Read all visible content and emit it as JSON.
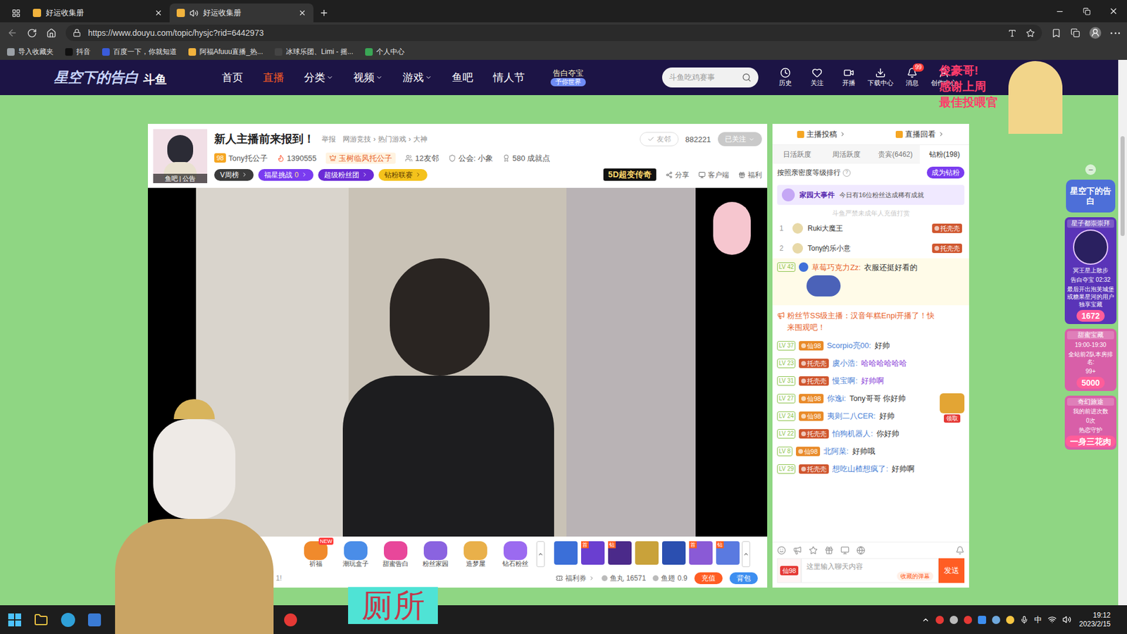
{
  "browser": {
    "tabs": [
      {
        "label": "好运收集册",
        "selected": false,
        "audio": false
      },
      {
        "label": "好运收集册",
        "selected": true,
        "audio": true
      }
    ],
    "url": "https://www.douyu.com/topic/hysjc?rid=6442973",
    "bookmarks": [
      "导入收藏夹",
      "抖音",
      "百度一下，你就知道",
      "阿福Afuuu直播_热...",
      "冰球乐团、Limi - 摇...",
      "个人中心"
    ]
  },
  "site": {
    "logo_title": "星空下的告白",
    "logo_brand": "斗鱼",
    "nav": [
      {
        "label": "首页",
        "selected": false,
        "dropdown": false
      },
      {
        "label": "直播",
        "selected": true,
        "dropdown": false
      },
      {
        "label": "分类",
        "selected": false,
        "dropdown": true
      },
      {
        "label": "视频",
        "selected": false,
        "dropdown": true
      },
      {
        "label": "游戏",
        "selected": false,
        "dropdown": true
      },
      {
        "label": "鱼吧",
        "selected": false,
        "dropdown": false
      },
      {
        "label": "情人节",
        "selected": false,
        "dropdown": false
      }
    ],
    "promo": {
      "title": "告白夺宝",
      "sub": "予你世界"
    },
    "search_placeholder": "斗鱼吃鸡赛事",
    "actions": [
      {
        "label": "历史",
        "badge": ""
      },
      {
        "label": "关注",
        "badge": ""
      },
      {
        "label": "开播",
        "badge": ""
      },
      {
        "label": "下载中心",
        "badge": ""
      },
      {
        "label": "消息",
        "badge": "99"
      },
      {
        "label": "创作中心",
        "badge": ""
      }
    ],
    "banner": [
      "俊豪哥!",
      "感谢上周",
      "最佳投喂官"
    ]
  },
  "room": {
    "avatar_label": "鱼吧 | 公告",
    "title": "新人主播前来报到！",
    "report": "举报",
    "category": [
      "网游竞技",
      "热门游戏",
      "大神"
    ],
    "category_sep": "›",
    "level": "98",
    "anchor": "Tony托公子",
    "heat": "1390555",
    "honor": "玉树临风托公子",
    "stats": [
      "12友邻",
      "公会: 小象",
      "580 成就点"
    ],
    "friend": "友邻",
    "followers": "882221",
    "follow": "已关注",
    "pills": [
      {
        "label": "V周榜",
        "count": "",
        "color": "#3b3b3b"
      },
      {
        "label": "福星挑战",
        "count": "0",
        "color": "#7a3cf0"
      },
      {
        "label": "超级粉丝团",
        "count": "",
        "color": "#6b2bd6"
      },
      {
        "label": "钻粉联赛",
        "count": "",
        "color": "#f4c21c"
      }
    ],
    "ad": "5D超变传奇",
    "links": [
      "分享",
      "客户端",
      "福利"
    ],
    "gifts": [
      {
        "label": "祈福",
        "badge": "NEW",
        "color": "#f08a2c"
      },
      {
        "label": "潮玩盒子",
        "badge": "",
        "color": "#4a8de8"
      },
      {
        "label": "甜蜜告白",
        "badge": "",
        "color": "#e8479a"
      },
      {
        "label": "粉丝家园",
        "badge": "",
        "color": "#8a63e0"
      },
      {
        "label": "造梦屋",
        "badge": "",
        "color": "#e9b04a"
      },
      {
        "label": "钻石粉丝",
        "badge": "",
        "color": "#9b6af0"
      }
    ],
    "quick_gifts": [
      {
        "tag": "",
        "color": "#3b6fd8"
      },
      {
        "tag": "首",
        "color": "#6a3fd0"
      },
      {
        "tag": "钻",
        "color": "#4b2a8a"
      },
      {
        "tag": "",
        "color": "#c9a23a"
      },
      {
        "tag": "",
        "color": "#2b4fb0"
      },
      {
        "tag": "首",
        "color": "#8a5ad6"
      },
      {
        "tag": "钻",
        "color": "#5a7ae0"
      }
    ],
    "left_hint": "1!",
    "welfare": "福利券",
    "yuwan_label": "鱼丸",
    "yuwan": "16571",
    "yuchi_label": "鱼翅",
    "yuchi": "0.9",
    "recharge": "充值",
    "bag": "背包"
  },
  "chat": {
    "top_tabs": [
      "主播投稿",
      "直播回看"
    ],
    "sub_tabs": [
      {
        "label": "日活跃度",
        "selected": false
      },
      {
        "label": "周活跃度",
        "selected": false
      },
      {
        "label": "贵宾(6462)",
        "selected": false
      },
      {
        "label": "钻粉(198)",
        "selected": true
      }
    ],
    "sort_label": "按照亲密度等级排行",
    "help": "?",
    "become": "成为钻粉",
    "event_title": "家园大事件",
    "event_text": "今日有16位粉丝达成稀有成就",
    "notice": "斗鱼严禁未成年人充值打赏",
    "ranks": [
      {
        "rank": "1",
        "name": "Ruki大魔王",
        "badge": "托壳壳"
      },
      {
        "rank": "2",
        "name": "Tony的乐小意",
        "badge": "托壳壳"
      }
    ],
    "pinned": {
      "level": "LV 42",
      "user": "草莓巧克力Zz:",
      "text": "衣服还挺好看的"
    },
    "system": "粉丝节SS级主播：汉音年糕Enpi开播了！快来围观吧！",
    "messages": [
      {
        "level": "LV 37",
        "badge": "仙98",
        "badge_color": "#e98b2a",
        "user": "Scorpio亮00:",
        "text": "好帅",
        "text_color": "#333333"
      },
      {
        "level": "LV 23",
        "badge": "托壳壳",
        "badge_color": "#d0572f",
        "user": "虞小浩:",
        "text": "哈哈哈哈哈哈",
        "text_color": "#8b3fd9"
      },
      {
        "level": "LV 31",
        "badge": "托壳壳",
        "badge_color": "#d0572f",
        "user": "慢宝啊:",
        "text": "好帅啊",
        "text_color": "#8b3fd9"
      },
      {
        "level": "LV 27",
        "badge": "仙98",
        "badge_color": "#e98b2a",
        "user": "你逸i:",
        "text": "Tony哥哥 你好帅",
        "text_color": "#333333"
      },
      {
        "level": "LV 24",
        "badge": "仙98",
        "badge_color": "#e98b2a",
        "user": "夷则二八CER:",
        "text": "好帅",
        "text_color": "#333333"
      },
      {
        "level": "LV 22",
        "badge": "托壳壳",
        "badge_color": "#d0572f",
        "user": "怕狗机器人:",
        "text": "你好帅",
        "text_color": "#333333"
      },
      {
        "level": "LV 8",
        "badge": "仙98",
        "badge_color": "#e98b2a",
        "user": "北阿菜:",
        "text": "好帅哦",
        "text_color": "#333333"
      },
      {
        "level": "LV 29",
        "badge": "托壳壳",
        "badge_color": "#d0572f",
        "user": "想吃山楂想疯了:",
        "text": "好帅啊",
        "text_color": "#333333"
      }
    ],
    "chest": "领取",
    "input_badge": "仙98",
    "placeholder": "这里输入聊天内容",
    "saved": "收藏的弹幕",
    "send": "发送"
  },
  "side": {
    "collapse": "−",
    "header": "星空下的告白",
    "cards": [
      {
        "kind": "featured",
        "title": "星子都崇崇拜",
        "lines": [
          "冥王星上散步",
          "告白夺宝 02:32",
          "最后开出泡芙城堡或糖果星河的用户独享宝藏"
        ],
        "value": "1672"
      },
      {
        "kind": "plain",
        "title": "甜蜜宝藏",
        "lines": [
          "19:00-19:30",
          "全站前2队本房排名:",
          "99+"
        ],
        "value": "5000"
      },
      {
        "kind": "plain",
        "title": "奇幻旅途",
        "lines": [
          "我的前进次数",
          "0次",
          "热恋守护"
        ],
        "value": "一身三花肉"
      }
    ]
  },
  "overlay": {
    "caption": "厕所"
  },
  "taskbar": {
    "lang": "中",
    "time": "19:12",
    "date": "2023/2/15"
  }
}
